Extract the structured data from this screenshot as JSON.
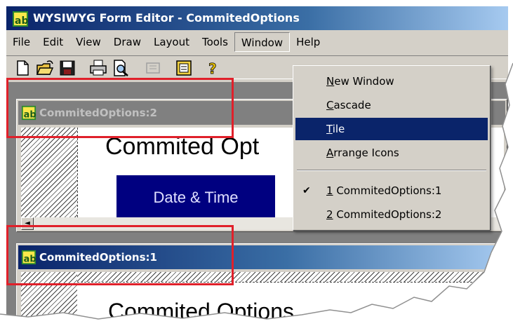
{
  "window": {
    "title": "WYSIWYG Form Editor - CommitedOptions",
    "icon": "app-ab-icon"
  },
  "menubar": {
    "items": [
      "File",
      "Edit",
      "View",
      "Draw",
      "Layout",
      "Tools",
      "Window",
      "Help"
    ],
    "open_menu": "Window"
  },
  "toolbar": {
    "buttons": [
      "new-icon",
      "open-icon",
      "save-icon",
      "print-icon",
      "print-preview-icon",
      "disabled-icon",
      "page-icon",
      "help-icon"
    ]
  },
  "window_menu": {
    "items": [
      {
        "label": "New Window",
        "mnemonic": "N",
        "rest": "ew Window"
      },
      {
        "label": "Cascade",
        "mnemonic": "C",
        "rest": "ascade"
      },
      {
        "label": "Tile",
        "mnemonic": "T",
        "rest": "ile",
        "highlighted": true
      },
      {
        "label": "Arrange Icons",
        "mnemonic": "A",
        "rest": "rrange Icons"
      }
    ],
    "windows": [
      {
        "number": "1",
        "name": " CommitedOptions:1",
        "checked": true
      },
      {
        "number": "2",
        "name": " CommitedOptions:2",
        "checked": false
      }
    ],
    "check_glyph": "✔"
  },
  "child_windows": {
    "second": {
      "title": "CommitedOptions:2",
      "heading": "Commited Opt",
      "button_label": "Date & Time",
      "scroll_arrow": "◄"
    },
    "first": {
      "title": "CommitedOptions:1",
      "heading": "Commited Options"
    }
  },
  "colors": {
    "highlight_outline": "#e0202a",
    "active_title": "#0a246a",
    "inactive_title": "#808080",
    "button_fill": "#000080"
  }
}
